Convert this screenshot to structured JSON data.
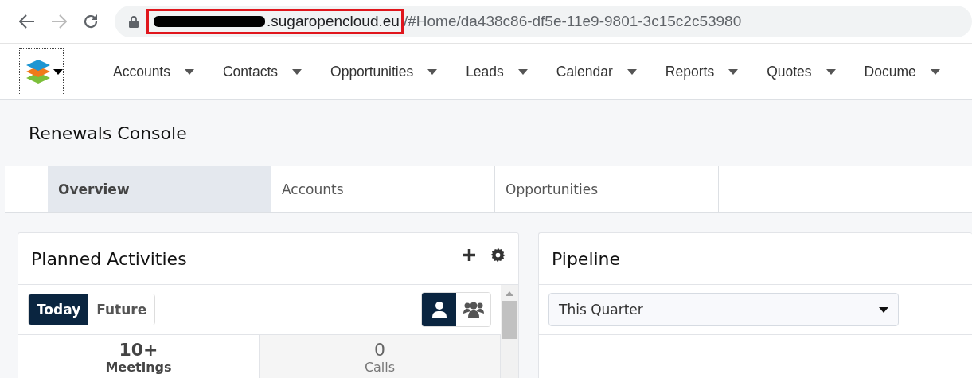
{
  "browser": {
    "url": {
      "host": ".sugaropencloud.eu",
      "path": "/#Home/da438c86-df5e-11e9-9801-3c15c2c53980",
      "redacted": true,
      "highlighted": true
    }
  },
  "nav": {
    "items": [
      {
        "label": "Accounts"
      },
      {
        "label": "Contacts"
      },
      {
        "label": "Opportunities"
      },
      {
        "label": "Leads"
      },
      {
        "label": "Calendar"
      },
      {
        "label": "Reports"
      },
      {
        "label": "Quotes"
      },
      {
        "label": "Docume"
      }
    ]
  },
  "page": {
    "title": "Renewals Console"
  },
  "tabs": [
    {
      "label": "Overview",
      "selected": true
    },
    {
      "label": "Accounts",
      "selected": false
    },
    {
      "label": "Opportunities",
      "selected": false
    }
  ],
  "dashlets": [
    {
      "kind": "activities",
      "title": "Planned Activities",
      "filters": [
        {
          "label": "Today",
          "selected": true
        },
        {
          "label": "Future",
          "selected": false
        }
      ],
      "scopes": [
        {
          "kind": "user",
          "selected": true
        },
        {
          "kind": "group",
          "selected": false
        }
      ],
      "counts": [
        {
          "value": "10+",
          "label": "Meetings",
          "selected": true
        },
        {
          "value": "0",
          "label": "Calls",
          "selected": false
        }
      ]
    },
    {
      "kind": "pipeline",
      "title": "Pipeline",
      "dropdown": {
        "value": "This Quarter"
      }
    }
  ]
}
